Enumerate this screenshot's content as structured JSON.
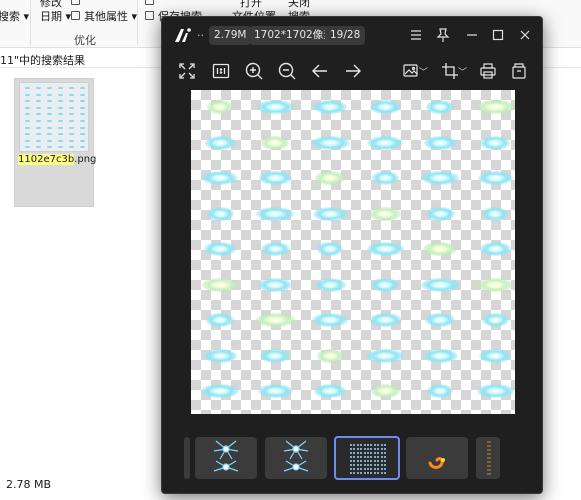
{
  "explorer": {
    "ribbon": {
      "sort_cut": "搜索",
      "modify_date_1": "修改",
      "modify_date_2": "日期",
      "other_props": "其他属性",
      "save_search": "保存搜索",
      "open_1": "打开",
      "open_2": "文件位置",
      "close_1": "关闭",
      "close_2": "搜索",
      "group_label": "优化"
    },
    "address": "11\"中的搜索结果",
    "file": {
      "name_highlight": "1102e7c3b",
      "name_ext": ".png"
    },
    "status": {
      "size": "2.78 MB"
    }
  },
  "viewer": {
    "title_ellipsis": "..",
    "file_size": "2.79M",
    "dimensions": "1702*1702像素",
    "position": "19/28",
    "accent_color": "#6f8cf0",
    "background_color": "#1f1f1f",
    "toolbar_icons": [
      "fullscreen-icon",
      "actual-size-icon",
      "zoom-in-icon",
      "zoom-out-icon",
      "previous-icon",
      "next-icon",
      "image-menu-icon",
      "crop-icon",
      "print-icon",
      "export-icon"
    ],
    "title_icons": [
      "menu-icon",
      "pin-icon",
      "minimize-icon",
      "maximize-icon",
      "close-icon"
    ],
    "filmstrip": [
      "blue-star-burst",
      "blue-star-burst",
      "sprite-sheet-selected",
      "orange-swirl",
      "partial-frame"
    ]
  }
}
